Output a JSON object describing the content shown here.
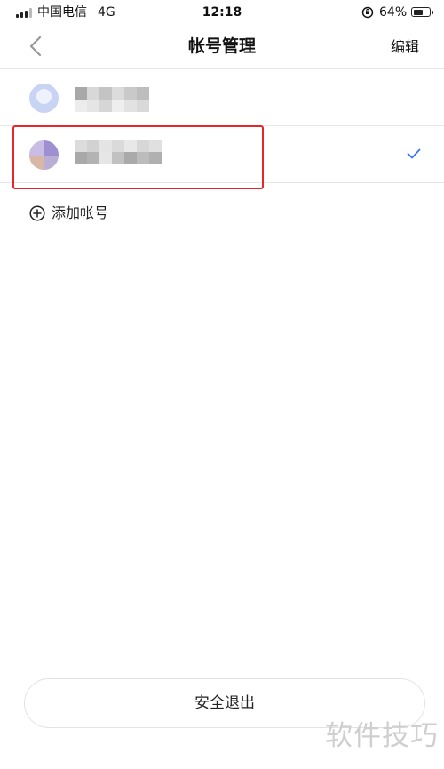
{
  "status_bar": {
    "carrier": "中国电信",
    "network": "4G",
    "time": "12:18",
    "battery_percent": "64%",
    "battery_level": 0.64
  },
  "nav": {
    "back_icon": "chevron-left-icon",
    "title": "帐号管理",
    "edit_label": "编辑"
  },
  "accounts": [
    {
      "selected": false
    },
    {
      "selected": true,
      "check_icon": "check-icon",
      "check_color": "#3478f6"
    }
  ],
  "add_account": {
    "icon": "plus-circle-icon",
    "label": "添加帐号"
  },
  "logout": {
    "label": "安全退出"
  },
  "watermark": {
    "text": "软件技巧"
  },
  "colors": {
    "highlight": "#e8252b",
    "accent": "#3478f6"
  }
}
